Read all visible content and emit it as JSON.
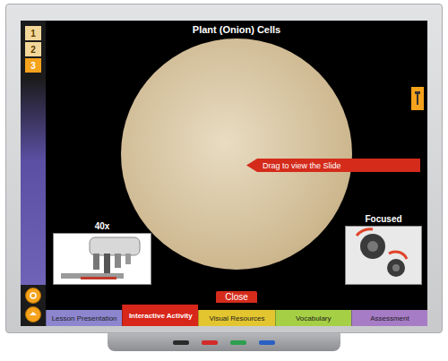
{
  "window": {
    "title": "Plant (Onion) Cells"
  },
  "pages": [
    {
      "label": "1",
      "selected": false
    },
    {
      "label": "2",
      "selected": false
    },
    {
      "label": "3",
      "selected": true
    }
  ],
  "slide_hint": "Drag to view the Slide",
  "magnification": "40x",
  "focus_status": "Focused",
  "close_button": "Close",
  "tabs": [
    {
      "label": "Lesson Presentation",
      "selected": false,
      "color": "#8d86cf"
    },
    {
      "label": "Interactive Activity",
      "selected": true,
      "color": "#d8261a"
    },
    {
      "label": "Visual Resources",
      "selected": false,
      "color": "#e3c52f"
    },
    {
      "label": "Vocabulary",
      "selected": false,
      "color": "#a5cf45"
    },
    {
      "label": "Assessment",
      "selected": false,
      "color": "#a77cc6"
    }
  ],
  "pens": [
    {
      "color": "#2a2a2a"
    },
    {
      "color": "#d32a2a"
    },
    {
      "color": "#2e9e4f"
    },
    {
      "color": "#2a5fc4"
    }
  ]
}
